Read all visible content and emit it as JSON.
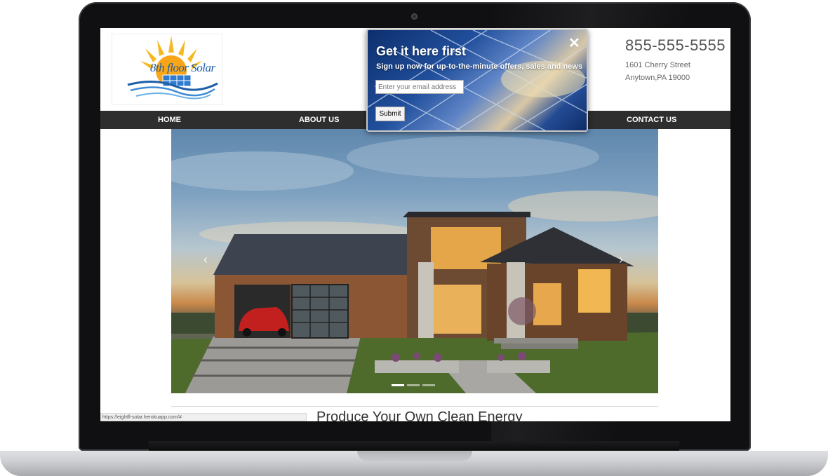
{
  "site": {
    "logo_text": "8th floor Solar",
    "phone": "855-555-5555",
    "address_line1": "1601 Cherry Street",
    "address_line2": "Anytown,PA 19000"
  },
  "nav": {
    "items": [
      {
        "label": "HOME"
      },
      {
        "label": "ABOUT US"
      },
      {
        "label": "CONTACT US"
      }
    ]
  },
  "popup": {
    "title": "Get it here first",
    "subtitle": "Sign up now for up-to-the-minute offers, sales and news",
    "email_placeholder": "Enter your email address",
    "submit_label": "Submit",
    "close_glyph": "✕"
  },
  "carousel": {
    "prev_glyph": "‹",
    "next_glyph": "›",
    "slide_count": 3,
    "active_index": 0
  },
  "main": {
    "heading": "Produce Your Own Clean Energy"
  },
  "status_bar": {
    "url": "https://eightfl-solar.herokuapp.com/#"
  },
  "colors": {
    "nav_bg": "#2e2e2e",
    "logo_blue": "#1c5fa8",
    "sun_yellow": "#f5b820"
  }
}
